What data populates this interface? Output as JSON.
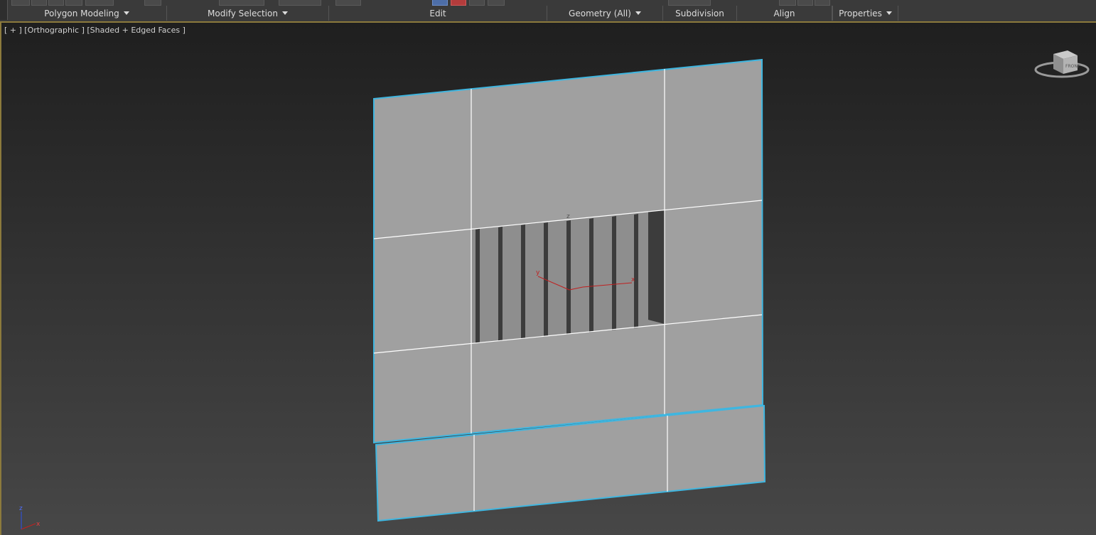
{
  "ribbon": {
    "sections": [
      {
        "label": "Polygon Modeling",
        "dropdown": true
      },
      {
        "label": "Modify Selection",
        "dropdown": true
      },
      {
        "label": "Edit",
        "dropdown": false
      },
      {
        "label": "Geometry (All)",
        "dropdown": true
      },
      {
        "label": "Subdivision",
        "dropdown": false
      },
      {
        "label": "Align",
        "dropdown": false
      },
      {
        "label": "Properties",
        "dropdown": true
      }
    ],
    "border_color": "#8c7a3c"
  },
  "viewport": {
    "label_plus": "[ + ]",
    "label_view": "[Orthographic ]",
    "label_shading": "[Shaded + Edged Faces ]",
    "selection_color": "#3fb6e0"
  },
  "gizmo": {
    "z_label": "z",
    "y_label": "y",
    "x_label": "x"
  },
  "axis_tripod": {
    "z_label": "z",
    "x_label": "x"
  },
  "viewcube": {
    "face_label": "FRONT"
  }
}
